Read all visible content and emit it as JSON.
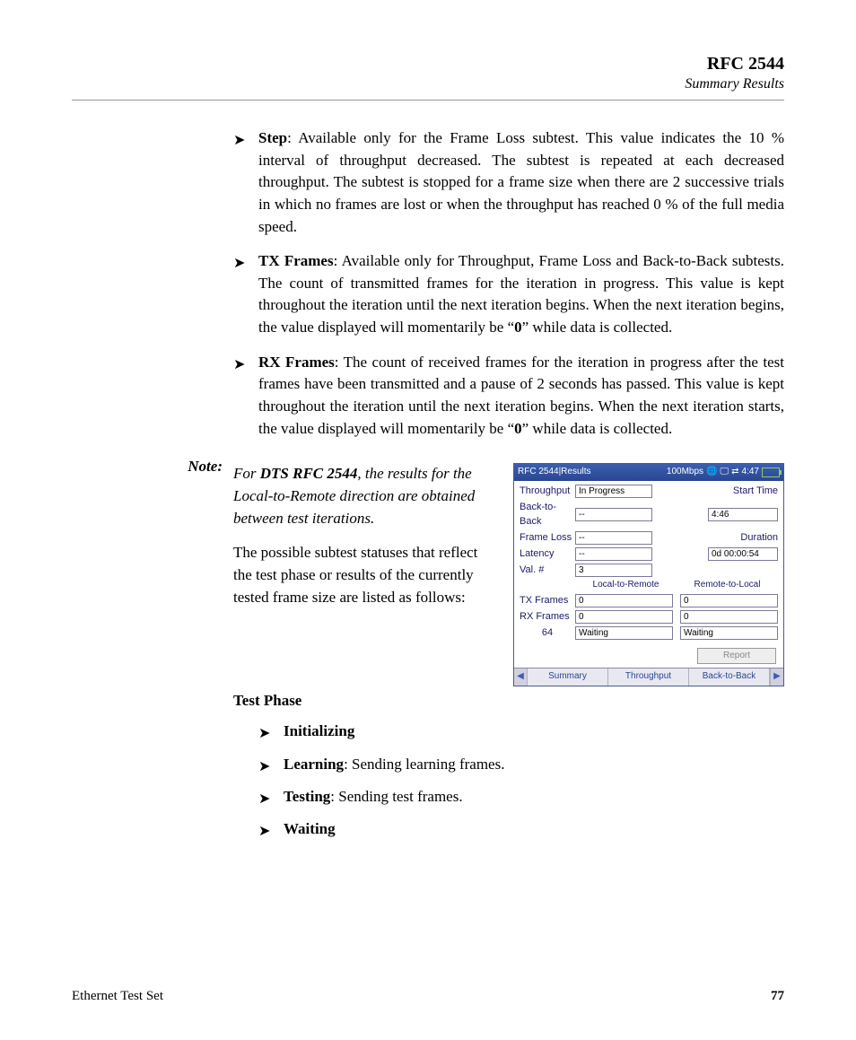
{
  "header": {
    "title": "RFC 2544",
    "subtitle": "Summary Results"
  },
  "bullets": [
    {
      "term": "Step",
      "rest": ": Available only for the Frame Loss subtest. This value indicates the 10 % interval of throughput decreased. The subtest is repeated at each decreased throughput. The subtest is stopped for a frame size when there are 2 successive trials in which no frames are lost or when the throughput has reached 0 % of the full media speed."
    },
    {
      "term": "TX Frames",
      "rest": ": Available only for Throughput, Frame Loss and Back-to-Back subtests. The count of transmitted frames for the iteration in progress. This value is kept throughout the iteration until the next iteration begins. When the next iteration begins, the value displayed will momentarily be “",
      "boldmid": "0",
      "after": "” while data is collected."
    },
    {
      "term": "RX Frames",
      "rest": ": The count of received frames for the iteration in progress after the test frames have been transmitted and a pause of 2 seconds has passed. This value is kept throughout the iteration until the next iteration begins. When the next iteration starts, the value displayed will momentarily be “",
      "boldmid": "0",
      "after": "” while data is collected."
    }
  ],
  "note": {
    "label": "Note:",
    "pre": "For ",
    "bold": "DTS RFC 2544",
    "post": ", the results for the Local-to-Remote direction are obtained between test iterations."
  },
  "para1": "The possible subtest statuses that reflect the test phase or results of the currently tested frame size are listed as follows:",
  "testPhaseHeader": "Test Phase",
  "phaseBullets": [
    {
      "term": "Initializing",
      "rest": ""
    },
    {
      "term": "Learning",
      "rest": ": Sending learning frames."
    },
    {
      "term": "Testing",
      "rest": ": Sending test frames."
    },
    {
      "term": "Waiting",
      "rest": ""
    }
  ],
  "device": {
    "title": "RFC 2544|Results",
    "speed": "100Mbps",
    "time": "4:47",
    "rows": {
      "throughput_label": "Throughput",
      "throughput_value": "In Progress",
      "start_label": "Start Time",
      "start_value": "4:46",
      "b2b_label": "Back-to-Back",
      "b2b_value": "--",
      "duration_label": "Duration",
      "duration_value": "0d 00:00:54",
      "fl_label": "Frame Loss",
      "fl_value": "--",
      "lat_label": "Latency",
      "lat_value": "--",
      "val_label": "Val. #",
      "val_value": "3",
      "ltr": "Local-to-Remote",
      "rtl": "Remote-to-Local",
      "txf_label": "TX Frames",
      "txf_l": "0",
      "txf_r": "0",
      "rxf_label": "RX Frames",
      "rxf_l": "0",
      "rxf_r": "0",
      "size_label": "64",
      "size_l": "Waiting",
      "size_r": "Waiting",
      "report": "Report"
    },
    "tabs": [
      "Summary",
      "Throughput",
      "Back-to-Back"
    ]
  },
  "footer": {
    "left": "Ethernet Test Set",
    "page": "77"
  }
}
